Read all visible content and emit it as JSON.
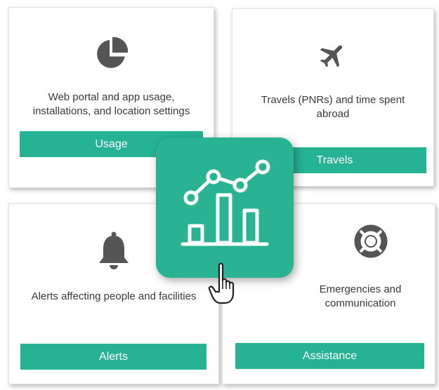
{
  "colors": {
    "accent": "#26b394",
    "icon_gray": "#555555",
    "text": "#3a3a3a",
    "button_text": "#ffffff"
  },
  "cards": {
    "usage": {
      "icon": "pie-chart-icon",
      "description": "Web portal and app usage, installations, and location settings",
      "button_label": "Usage"
    },
    "travels": {
      "icon": "airplane-icon",
      "description": "Travels (PNRs) and time spent abroad",
      "button_label": "Travels"
    },
    "alerts": {
      "icon": "bell-icon",
      "description": "Alerts affecting people and facilities",
      "button_label": "Alerts"
    },
    "assistance": {
      "icon": "lifebuoy-icon",
      "description": "Emergencies and communication",
      "button_label": "Assistance"
    }
  },
  "hero": {
    "icon": "analytics-chart-icon"
  },
  "cursor": {
    "icon": "hand-pointer-icon"
  }
}
